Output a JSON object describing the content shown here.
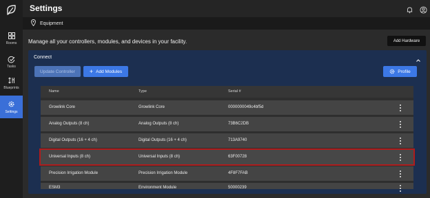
{
  "sidebar": {
    "logo": "leaf-logo-icon",
    "items": [
      {
        "label": "Rooms",
        "icon": "rooms-grid-icon",
        "active": false
      },
      {
        "label": "Tasks",
        "icon": "tasks-check-icon",
        "active": false
      },
      {
        "label": "Blueprints",
        "icon": "blueprints-icon",
        "active": false
      },
      {
        "label": "Settings",
        "icon": "gear-icon",
        "active": true
      }
    ]
  },
  "header": {
    "title": "Settings",
    "icons": [
      "bell-icon",
      "user-account-icon"
    ]
  },
  "breadcrumb": {
    "icon": "location-pin-icon",
    "label": "Equipment"
  },
  "intro": {
    "text": "Manage all your controllers, modules, and devices in your facility.",
    "add_hardware_label": "Add Hardware"
  },
  "connect": {
    "title": "Connect",
    "update_controller_label": "Update Controller",
    "add_modules_label": "Add Modules",
    "profile_label": "Profile",
    "table": {
      "columns": [
        "Name",
        "Type",
        "Serial #"
      ],
      "rows": [
        {
          "name": "Growlink Core",
          "type": "Growlink Core",
          "serial": "0000000049c4bf5d",
          "highlighted": false
        },
        {
          "name": "Analog Outputs (8 ch)",
          "type": "Analog Outputs (8 ch)",
          "serial": "73B6C2DB",
          "highlighted": false
        },
        {
          "name": "Digital Outputs (16 + 4 ch)",
          "type": "Digital Outputs (16 + 4 ch)",
          "serial": "713A9740",
          "highlighted": false
        },
        {
          "name": "Universal Inputs (8 ch)",
          "type": "Universal Inputs (8 ch)",
          "serial": "63F00728",
          "highlighted": true
        },
        {
          "name": "Precision Irrigation Module",
          "type": "Precision Irrigation Module",
          "serial": "4F8F7FAB",
          "highlighted": false
        },
        {
          "name": "ESM3",
          "type": "Environment Module",
          "serial": "50000239",
          "highlighted": false
        }
      ]
    }
  },
  "colors": {
    "sidebar_bg": "#1e1e1e",
    "active_nav": "#3a6fd8",
    "panel_bg": "#1c2f50",
    "primary_button": "#3c78e6",
    "highlight_border": "#b01c1c"
  }
}
